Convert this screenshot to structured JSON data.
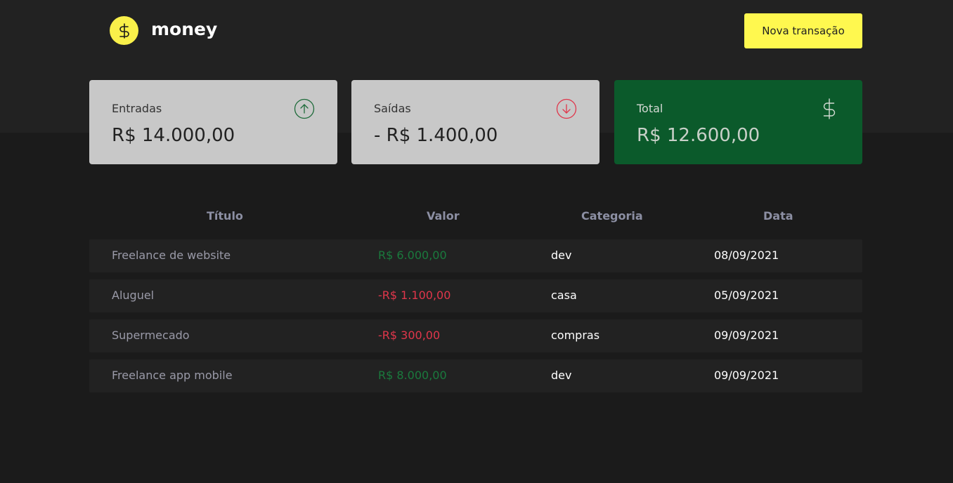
{
  "header": {
    "logo_text": "money",
    "new_transaction_label": "Nova transação"
  },
  "summary": {
    "income": {
      "label": "Entradas",
      "value": "R$ 14.000,00"
    },
    "outcome": {
      "label": "Saídas",
      "value": "- R$ 1.400,00"
    },
    "total": {
      "label": "Total",
      "value": "R$ 12.600,00"
    }
  },
  "table": {
    "headers": [
      "Título",
      "Valor",
      "Categoria",
      "Data"
    ],
    "rows": [
      {
        "title": "Freelance de website",
        "value": "R$ 6.000,00",
        "category": "dev",
        "date": "08/09/2021"
      },
      {
        "title": "Aluguel",
        "value": "-R$ 1.100,00",
        "category": "casa",
        "date": "05/09/2021"
      },
      {
        "title": "Supermecado",
        "value": "-R$ 300,00",
        "category": "compras",
        "date": "09/09/2021"
      },
      {
        "title": "Freelance app mobile",
        "value": "R$ 8.000,00",
        "category": "dev",
        "date": "09/09/2021"
      }
    ]
  },
  "colors": {
    "accent_yellow": "#fff84f",
    "income_green": "#1a7a3d",
    "outcome_red": "#e0364b",
    "total_card": "#0b5a2b"
  }
}
